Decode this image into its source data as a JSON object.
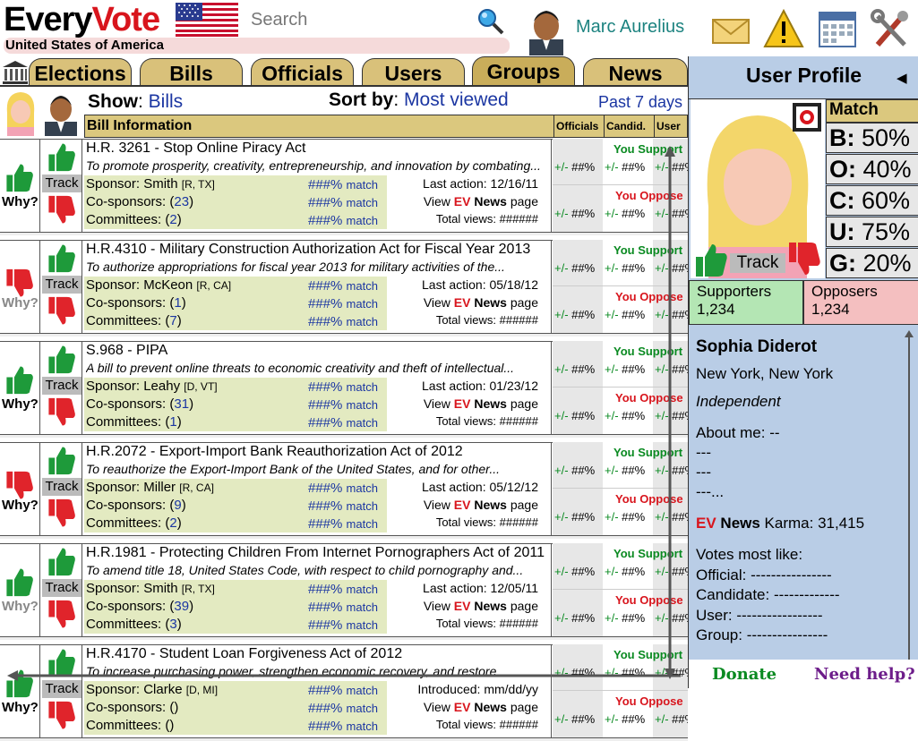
{
  "header": {
    "logo_every": "Every",
    "logo_vote": "Vote",
    "country": "United States of America",
    "search_placeholder": "Search",
    "username": "Marc Aurelius"
  },
  "tabs": [
    "Elections",
    "Bills",
    "Officials",
    "Users",
    "Groups",
    "News"
  ],
  "show_bar": {
    "show_label": "Show",
    "show_value": "Bills",
    "sort_label": "Sort by",
    "sort_value": "Most viewed",
    "period": "Past 7 days"
  },
  "columns": {
    "info": "Bill Information",
    "officials": "Officials",
    "candidates": "Candid.",
    "users": "User"
  },
  "labels": {
    "why": "Why?",
    "track": "Track",
    "sponsor": "Sponsor:",
    "cosponsors": "Co-sponsors:",
    "committees": "Committees:",
    "match_value": "###%",
    "match_word": "match",
    "view_prefix": "View ",
    "view_ev": "EV",
    "view_news": " News",
    "view_suffix": " page",
    "total_views": "Total views: ######",
    "you_support": "You Support",
    "you_oppose": "You Oppose",
    "pm": "+/-",
    "hash": "##%"
  },
  "bills": [
    {
      "title": "H.R. 3261 - Stop Online Piracy Act",
      "desc": "To promote prosperity, creativity, entrepreneurship, and innovation by combating...",
      "sponsor": "Smith",
      "party": "[R, TX]",
      "cosponsors": "23",
      "committees": "2",
      "action": "Last action: 12/16/11",
      "vote": "up",
      "why_active": true
    },
    {
      "title": "H.R.4310 - Military Construction Authorization Act for Fiscal Year 2013",
      "desc": "To authorize appropriations for fiscal year 2013 for military activities of the...",
      "sponsor": "McKeon",
      "party": "[R, CA]",
      "cosponsors": "1",
      "committees": "7",
      "action": "Last action: 05/18/12",
      "vote": "down",
      "why_active": false
    },
    {
      "title": "S.968 - PIPA",
      "desc": "A bill to prevent online threats to economic creativity and theft of intellectual...",
      "sponsor": "Leahy",
      "party": "[D, VT]",
      "cosponsors": "31",
      "committees": "1",
      "action": "Last action: 01/23/12",
      "vote": "up",
      "why_active": true
    },
    {
      "title": "H.R.2072 - Export-Import Bank Reauthorization Act of 2012",
      "desc": "To reauthorize the Export-Import Bank of the United States, and for other...",
      "sponsor": "Miller",
      "party": "[R, CA]",
      "cosponsors": "9",
      "committees": "2",
      "action": "Last action: 05/12/12",
      "vote": "down",
      "why_active": true
    },
    {
      "title": "H.R.1981 - Protecting Children From Internet Pornographers Act of 2011",
      "desc": "To amend title 18, United States Code, with respect to child pornography and...",
      "sponsor": "Smith",
      "party": "[R, TX]",
      "cosponsors": "39",
      "committees": "3",
      "action": "Last action: 12/05/11",
      "vote": "up",
      "why_active": false
    },
    {
      "title": "H.R.4170 - Student Loan Forgiveness Act of 2012",
      "desc": "To increase purchasing power, strengthen economic recovery, and restore...",
      "sponsor": "Clarke",
      "party": "[D, MI]",
      "cosponsors": "",
      "committees": "",
      "action": "Introduced: mm/dd/yy",
      "vote": "up",
      "why_active": true
    }
  ],
  "profile": {
    "title": "User Profile",
    "track": "Track",
    "match_header": "Match",
    "matches": [
      {
        "letter": "B:",
        "value": "50%"
      },
      {
        "letter": "O:",
        "value": "40%"
      },
      {
        "letter": "C:",
        "value": "60%"
      },
      {
        "letter": "U:",
        "value": "75%"
      },
      {
        "letter": "G:",
        "value": "20%"
      }
    ],
    "supporters_label": "Supporters",
    "supporters_count": "1,234",
    "opposers_label": "Opposers",
    "opposers_count": "1,234",
    "name": "Sophia Diderot",
    "location": "New York, New York",
    "affiliation": "Independent",
    "about_label": "About me: --",
    "about_lines": [
      "---",
      "---",
      "---..."
    ],
    "karma_ev": "EV",
    "karma_news": " News",
    "karma_rest": " Karma: 31,415",
    "votes_like": "Votes most like:",
    "like_official": "Official: ----------------",
    "like_candidate": "Candidate: -------------",
    "like_user": "User: -----------------",
    "like_group": "Group: ----------------",
    "donate": "Donate",
    "help": "Need help?"
  }
}
